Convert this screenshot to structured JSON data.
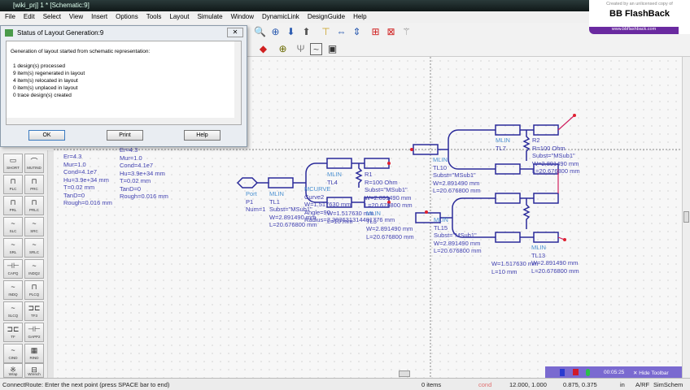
{
  "window": {
    "title": "[wiki_prj] 1 * [Schematic:9]"
  },
  "menu": [
    "File",
    "Edit",
    "Select",
    "View",
    "Insert",
    "Options",
    "Tools",
    "Layout",
    "Simulate",
    "Window",
    "DynamicLink",
    "DesignGuide",
    "Help"
  ],
  "watermark": {
    "top": "Created by an unlicensed copy of",
    "brand": "BB FlashBack",
    "url": "www.bbflashback.com"
  },
  "dialog": {
    "title": "Status of Layout Generation:9",
    "intro": "Generation of layout started from schematic representation:",
    "lines": [
      "1  design(s) processed",
      "9  item(s) regenerated in layout",
      "4  item(s) relocated in layout",
      "0  item(s) unplaced in layout",
      "0  trace design(s) created"
    ],
    "ok": "OK",
    "print": "Print",
    "help": "Help"
  },
  "substrate": {
    "params": [
      "Er=4.3",
      "Mur=1.0",
      "Cond=4.1e7",
      "Hu=3.9e+34 mm",
      "T=0.02 mm",
      "TanD=0",
      "Rough=0.016 mm"
    ]
  },
  "schematic": {
    "port": {
      "type": "Port",
      "name": "P1",
      "num": "Num=1"
    },
    "tl1": {
      "type": "MLIN",
      "name": "TL1",
      "subst": "Subst=\"MSub1\"",
      "w": "W=2.891490 mm",
      "l": "L=20.676800 mm"
    },
    "tl4": {
      "type": "MLIN",
      "name": "TL4"
    },
    "r1": {
      "type": "R",
      "name": "R1",
      "r": "R=100 Ohm",
      "subst": "Subst=\"MSub1\"",
      "w": "W=2.891490 mm",
      "l": "L=20.676800 mm"
    },
    "curve": {
      "type": "MCURVE",
      "name": "Curve2",
      "w": "W=1.517630 mm",
      "angle": "Angle=90",
      "radius": "Radius=3.383631314481776 mm"
    },
    "tl3": {
      "type": "MLIN",
      "name": "TL3",
      "w1": "W=1.517630 mm",
      "l1": "L=10 mm",
      "w2": "W=2.891490 mm",
      "l2": "L=20.676800 mm"
    },
    "tl10": {
      "type": "MLIN",
      "name": "TL10",
      "subst": "Subst=\"MSub1\"",
      "w": "W=2.891490 mm",
      "l": "L=20.676800 mm"
    },
    "tl7": {
      "type": "MLIN",
      "name": "TL7",
      "r2": "R2",
      "r": "R=100 Ohm",
      "subst": "Subst=\"MSub1\"",
      "w": "W=2.891490 mm",
      "l": "L=20.676800 mm"
    },
    "tl15": {
      "type": "MLIN",
      "name": "TL15",
      "subst": "Subst=\"MSub1\"",
      "w": "W=2.891490 mm",
      "l": "L=20.676800 mm"
    },
    "tl13": {
      "type": "MLIN",
      "name": "TL13",
      "w1": "W=1.517630 mm",
      "l1": "L=10 mm",
      "w2": "W=2.891490 mm",
      "l2": "L=20.676800 mm"
    }
  },
  "palette": [
    "SHORT",
    "MUTIND",
    "PLC",
    "PRC",
    "PRL",
    "PRLC",
    "SLC",
    "SRC",
    "SRL",
    "SRLC",
    "CAPQ",
    "INDQ2",
    "INDQ",
    "PLCQ",
    "SLCQ",
    "TF3",
    "TF",
    "GAPP2",
    "CIND",
    "RIND",
    "Wrap",
    "Wrench"
  ],
  "recorder": {
    "time": "00:05:25",
    "hide": "Hide Toolbar"
  },
  "status": {
    "message": "ConnectRoute: Enter the next point (press SPACE bar to end)",
    "items": "0 items",
    "cond": "cond",
    "coord1": "12.000, 1.000",
    "coord2": "0.875, 0.375",
    "unit": "in",
    "mode": "A/RF",
    "sim": "SimSchem"
  },
  "colors": {
    "wire": "#2a2a9a",
    "label": "#4040b0",
    "pin": "#e02030",
    "accent": "#6a4ac0"
  }
}
